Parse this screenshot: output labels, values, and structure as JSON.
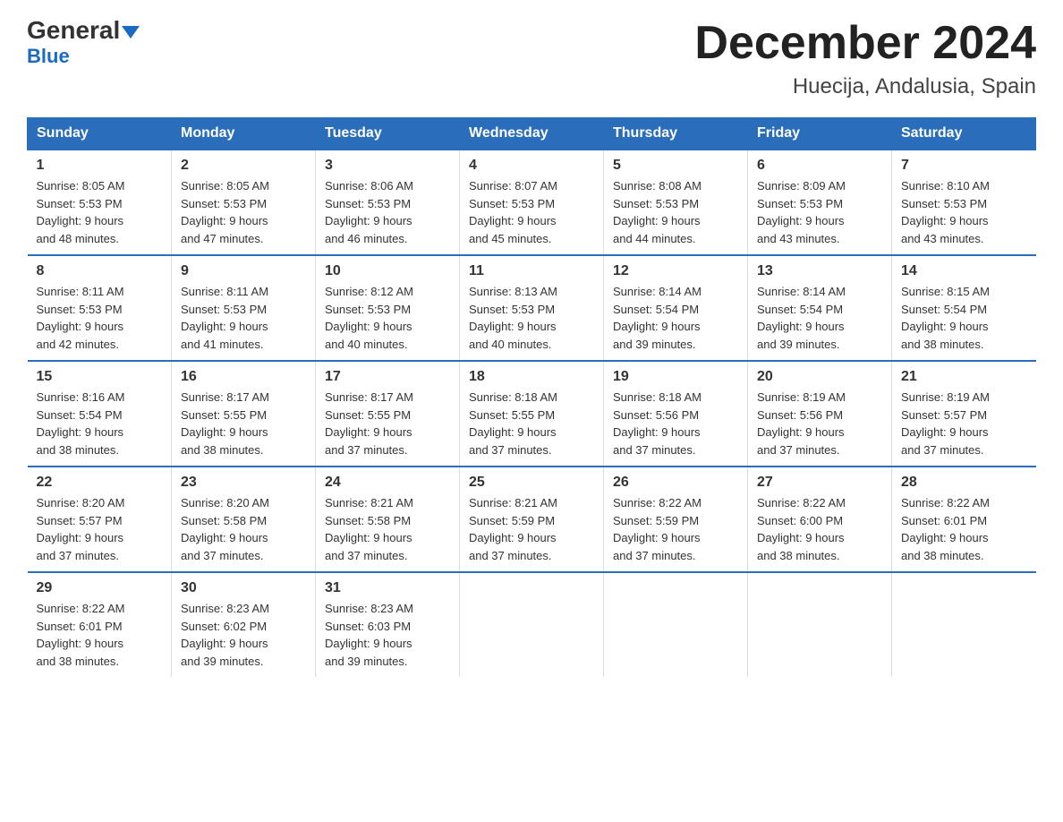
{
  "header": {
    "logo_general": "General",
    "logo_blue": "Blue",
    "month_title": "December 2024",
    "location": "Huecija, Andalusia, Spain"
  },
  "days_of_week": [
    "Sunday",
    "Monday",
    "Tuesday",
    "Wednesday",
    "Thursday",
    "Friday",
    "Saturday"
  ],
  "weeks": [
    [
      {
        "day": "1",
        "sunrise": "8:05 AM",
        "sunset": "5:53 PM",
        "daylight": "9 hours and 48 minutes."
      },
      {
        "day": "2",
        "sunrise": "8:05 AM",
        "sunset": "5:53 PM",
        "daylight": "9 hours and 47 minutes."
      },
      {
        "day": "3",
        "sunrise": "8:06 AM",
        "sunset": "5:53 PM",
        "daylight": "9 hours and 46 minutes."
      },
      {
        "day": "4",
        "sunrise": "8:07 AM",
        "sunset": "5:53 PM",
        "daylight": "9 hours and 45 minutes."
      },
      {
        "day": "5",
        "sunrise": "8:08 AM",
        "sunset": "5:53 PM",
        "daylight": "9 hours and 44 minutes."
      },
      {
        "day": "6",
        "sunrise": "8:09 AM",
        "sunset": "5:53 PM",
        "daylight": "9 hours and 43 minutes."
      },
      {
        "day": "7",
        "sunrise": "8:10 AM",
        "sunset": "5:53 PM",
        "daylight": "9 hours and 43 minutes."
      }
    ],
    [
      {
        "day": "8",
        "sunrise": "8:11 AM",
        "sunset": "5:53 PM",
        "daylight": "9 hours and 42 minutes."
      },
      {
        "day": "9",
        "sunrise": "8:11 AM",
        "sunset": "5:53 PM",
        "daylight": "9 hours and 41 minutes."
      },
      {
        "day": "10",
        "sunrise": "8:12 AM",
        "sunset": "5:53 PM",
        "daylight": "9 hours and 40 minutes."
      },
      {
        "day": "11",
        "sunrise": "8:13 AM",
        "sunset": "5:53 PM",
        "daylight": "9 hours and 40 minutes."
      },
      {
        "day": "12",
        "sunrise": "8:14 AM",
        "sunset": "5:54 PM",
        "daylight": "9 hours and 39 minutes."
      },
      {
        "day": "13",
        "sunrise": "8:14 AM",
        "sunset": "5:54 PM",
        "daylight": "9 hours and 39 minutes."
      },
      {
        "day": "14",
        "sunrise": "8:15 AM",
        "sunset": "5:54 PM",
        "daylight": "9 hours and 38 minutes."
      }
    ],
    [
      {
        "day": "15",
        "sunrise": "8:16 AM",
        "sunset": "5:54 PM",
        "daylight": "9 hours and 38 minutes."
      },
      {
        "day": "16",
        "sunrise": "8:17 AM",
        "sunset": "5:55 PM",
        "daylight": "9 hours and 38 minutes."
      },
      {
        "day": "17",
        "sunrise": "8:17 AM",
        "sunset": "5:55 PM",
        "daylight": "9 hours and 37 minutes."
      },
      {
        "day": "18",
        "sunrise": "8:18 AM",
        "sunset": "5:55 PM",
        "daylight": "9 hours and 37 minutes."
      },
      {
        "day": "19",
        "sunrise": "8:18 AM",
        "sunset": "5:56 PM",
        "daylight": "9 hours and 37 minutes."
      },
      {
        "day": "20",
        "sunrise": "8:19 AM",
        "sunset": "5:56 PM",
        "daylight": "9 hours and 37 minutes."
      },
      {
        "day": "21",
        "sunrise": "8:19 AM",
        "sunset": "5:57 PM",
        "daylight": "9 hours and 37 minutes."
      }
    ],
    [
      {
        "day": "22",
        "sunrise": "8:20 AM",
        "sunset": "5:57 PM",
        "daylight": "9 hours and 37 minutes."
      },
      {
        "day": "23",
        "sunrise": "8:20 AM",
        "sunset": "5:58 PM",
        "daylight": "9 hours and 37 minutes."
      },
      {
        "day": "24",
        "sunrise": "8:21 AM",
        "sunset": "5:58 PM",
        "daylight": "9 hours and 37 minutes."
      },
      {
        "day": "25",
        "sunrise": "8:21 AM",
        "sunset": "5:59 PM",
        "daylight": "9 hours and 37 minutes."
      },
      {
        "day": "26",
        "sunrise": "8:22 AM",
        "sunset": "5:59 PM",
        "daylight": "9 hours and 37 minutes."
      },
      {
        "day": "27",
        "sunrise": "8:22 AM",
        "sunset": "6:00 PM",
        "daylight": "9 hours and 38 minutes."
      },
      {
        "day": "28",
        "sunrise": "8:22 AM",
        "sunset": "6:01 PM",
        "daylight": "9 hours and 38 minutes."
      }
    ],
    [
      {
        "day": "29",
        "sunrise": "8:22 AM",
        "sunset": "6:01 PM",
        "daylight": "9 hours and 38 minutes."
      },
      {
        "day": "30",
        "sunrise": "8:23 AM",
        "sunset": "6:02 PM",
        "daylight": "9 hours and 39 minutes."
      },
      {
        "day": "31",
        "sunrise": "8:23 AM",
        "sunset": "6:03 PM",
        "daylight": "9 hours and 39 minutes."
      },
      null,
      null,
      null,
      null
    ]
  ],
  "labels": {
    "sunrise": "Sunrise:",
    "sunset": "Sunset:",
    "daylight": "Daylight:"
  }
}
